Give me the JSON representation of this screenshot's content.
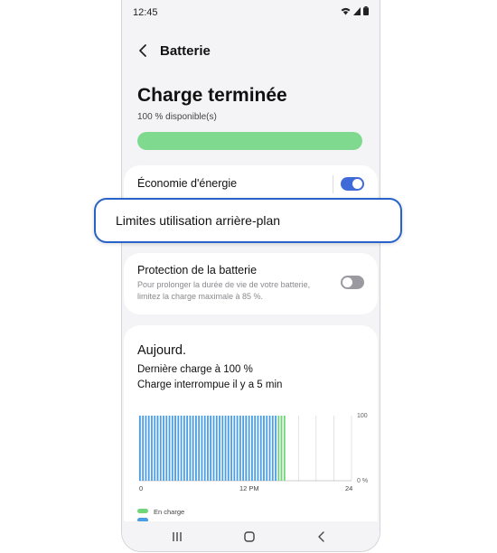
{
  "status": {
    "time": "12:45"
  },
  "header": {
    "title": "Batterie"
  },
  "battery": {
    "headline": "Charge terminée",
    "available": "100 % disponible(s)",
    "level_percent": 100
  },
  "power_saving": {
    "label": "Économie d'énergie",
    "enabled": true
  },
  "background_limits": {
    "label": "Limites utilisation arrière-plan"
  },
  "protection": {
    "label": "Protection de la batterie",
    "description": "Pour prolonger la durée de vie de votre batterie, limitez la charge maximale à 85 %.",
    "enabled": false
  },
  "usage": {
    "title": "Aujourd.",
    "last_charge": "Dernière charge à 100 %",
    "interrupted": "Charge interrompue il y a 5 min"
  },
  "chart_data": {
    "type": "bar",
    "x_ticks": [
      "0",
      "12 PM",
      "24"
    ],
    "y_ticks": [
      "100",
      "0 %"
    ],
    "ylim": [
      0,
      100
    ],
    "series": [
      {
        "name": "En charge",
        "color": "#6fd67a",
        "values": [
          0,
          0,
          0,
          0,
          0,
          0,
          0,
          0,
          0,
          0,
          0,
          0,
          0,
          0,
          0,
          0,
          0,
          0,
          0,
          0,
          0,
          0,
          0,
          0,
          0,
          0,
          0,
          0,
          0,
          0,
          0,
          0,
          0,
          0,
          0,
          0,
          0,
          0,
          0,
          0,
          0,
          0,
          0,
          0,
          0,
          0,
          0,
          100,
          100,
          100
        ]
      },
      {
        "name": "",
        "color": "#4a9ee6",
        "values": [
          100,
          100,
          100,
          100,
          100,
          100,
          100,
          100,
          100,
          100,
          100,
          100,
          100,
          100,
          100,
          100,
          100,
          100,
          100,
          100,
          100,
          100,
          100,
          100,
          100,
          100,
          100,
          100,
          100,
          100,
          100,
          100,
          100,
          100,
          100,
          100,
          100,
          100,
          100,
          100,
          100,
          100,
          100,
          100,
          100,
          100,
          100,
          0,
          0,
          0
        ]
      }
    ],
    "legend": [
      "En charge"
    ]
  },
  "colors": {
    "accent": "#3e6bd8",
    "battery_fill": "#7fd98e",
    "highlight_border": "#2762c9"
  },
  "icons": {
    "back": "back-arrow-icon",
    "wifi": "wifi-icon",
    "signal": "signal-icon",
    "battery": "battery-icon"
  }
}
